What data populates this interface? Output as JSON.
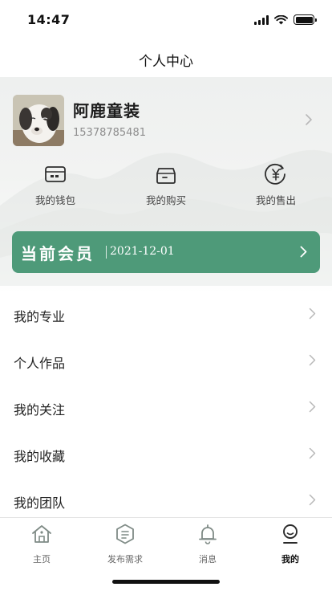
{
  "status_bar": {
    "time": "14:47"
  },
  "nav": {
    "title": "个人中心"
  },
  "profile": {
    "name": "阿鹿童装",
    "phone": "15378785481"
  },
  "quick_actions": [
    {
      "label": "我的钱包",
      "icon": "wallet-icon"
    },
    {
      "label": "我的购买",
      "icon": "purchase-box-icon"
    },
    {
      "label": "我的售出",
      "icon": "yuan-coin-icon"
    }
  ],
  "membership": {
    "title": "当前会员",
    "date": "2021-12-01"
  },
  "menu": [
    {
      "label": "我的专业"
    },
    {
      "label": "个人作品"
    },
    {
      "label": "我的关注"
    },
    {
      "label": "我的收藏"
    },
    {
      "label": "我的团队"
    }
  ],
  "tabs": [
    {
      "label": "主页",
      "icon": "home-icon"
    },
    {
      "label": "发布需求",
      "icon": "publish-icon"
    },
    {
      "label": "消息",
      "icon": "bell-icon"
    },
    {
      "label": "我的",
      "icon": "profile-icon",
      "active": true
    }
  ],
  "colors": {
    "accent": "#4e9a79",
    "tab_icon": "#7f8b86",
    "chevron": "#b8b8b8"
  }
}
